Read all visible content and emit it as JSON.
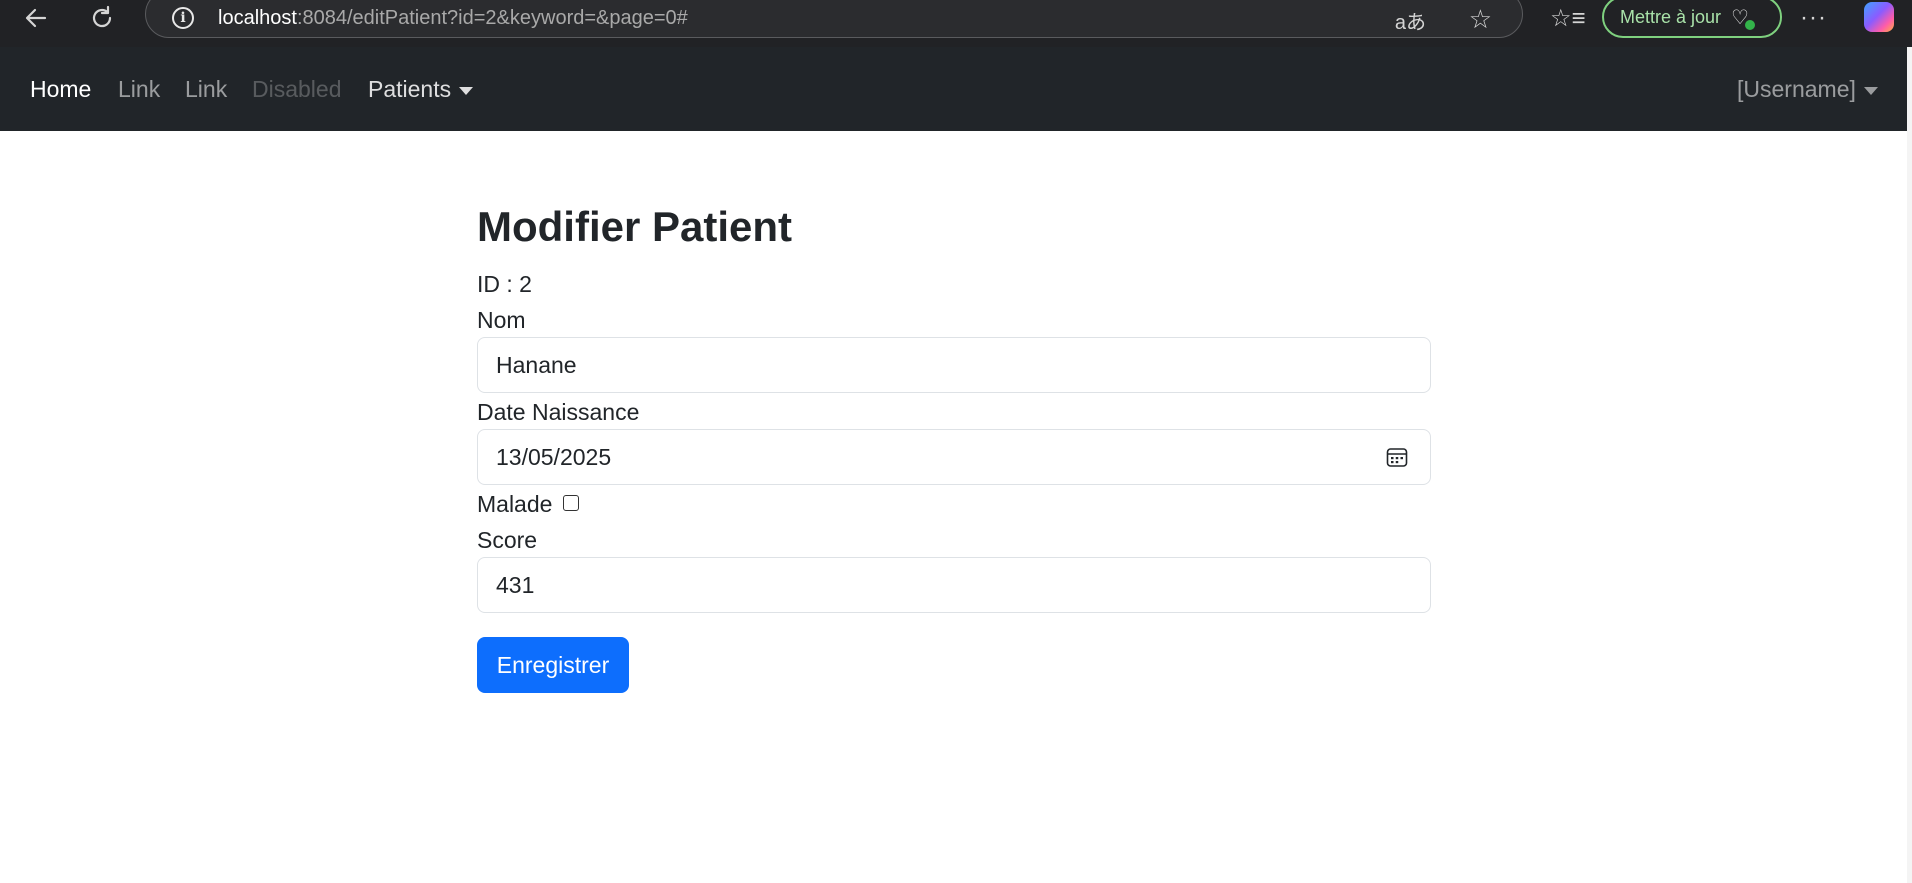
{
  "browser": {
    "url_host": "localhost",
    "url_rest": ":8084/editPatient?id=2&keyword=&page=0#",
    "update_button": "Mettre à jour",
    "icons": [
      "back-icon",
      "reload-icon",
      "info-icon",
      "read-aloud-icon",
      "favorite-star-icon",
      "favorites-icon",
      "heart-pulse-icon",
      "more-icon",
      "copilot-icon"
    ]
  },
  "navbar": {
    "home": "Home",
    "link1": "Link",
    "link2": "Link",
    "disabled": "Disabled",
    "patients": "Patients",
    "user": "[Username]"
  },
  "form": {
    "title": "Modifier Patient",
    "id_line": "ID : 2",
    "nom_label": "Nom",
    "nom_value": "Hanane",
    "date_label": "Date Naissance",
    "date_value": "13/05/2025",
    "malade_label": "Malade",
    "malade_checked": false,
    "score_label": "Score",
    "score_value": "431",
    "save_button": "Enregistrer"
  },
  "colors": {
    "navbar_bg": "#212529",
    "primary": "#0d6efd",
    "browser_bg": "#212225",
    "update_green": "#7fd17f"
  }
}
